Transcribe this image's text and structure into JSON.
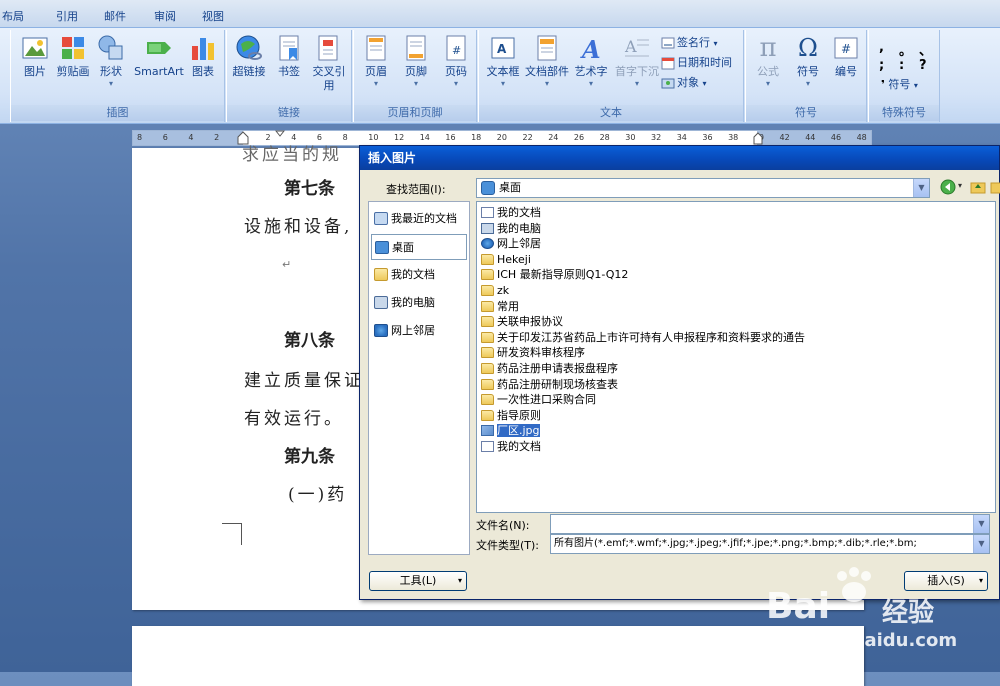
{
  "ribbon": {
    "tabs": [
      "布局",
      "引用",
      "邮件",
      "审阅",
      "视图"
    ],
    "groups": {
      "illustrations": {
        "label": "插图",
        "buttons": [
          "图片",
          "剪贴画",
          "形状",
          "SmartArt",
          "图表"
        ]
      },
      "links": {
        "label": "链接",
        "buttons": [
          "超链接",
          "书签",
          "交叉引用"
        ]
      },
      "header_footer": {
        "label": "页眉和页脚",
        "buttons": [
          "页眉",
          "页脚",
          "页码"
        ]
      },
      "text": {
        "label": "文本",
        "buttons": [
          "文本框",
          "文档部件",
          "艺术字",
          "首字下沉"
        ],
        "small": [
          "签名行",
          "日期和时间",
          "对象"
        ]
      },
      "symbols": {
        "label": "符号",
        "buttons": [
          "公式",
          "符号",
          "编号"
        ]
      },
      "special": {
        "label": "特殊符号",
        "chars": [
          ",",
          "。",
          "、",
          ";",
          ":",
          "?"
        ],
        "symbol_label": "符号"
      }
    }
  },
  "ruler": {
    "numbers": [
      "8",
      "6",
      "4",
      "2",
      "",
      "2",
      "4",
      "6",
      "8",
      "10",
      "12",
      "14",
      "16",
      "18",
      "20",
      "22",
      "24",
      "26",
      "28",
      "30",
      "32",
      "34",
      "36",
      "38",
      "40",
      "42",
      "44",
      "46",
      "48"
    ]
  },
  "document": {
    "lines": [
      {
        "text": "第七条",
        "style": "head"
      },
      {
        "text": "设施和设备,",
        "style": "body"
      },
      {
        "text": "第八条",
        "style": "head"
      },
      {
        "text": "建立质量保证",
        "style": "body"
      },
      {
        "text": "有效运行。",
        "style": "body"
      },
      {
        "text": "第九条",
        "style": "head"
      },
      {
        "text": "(一)药",
        "style": "body"
      }
    ],
    "partial_top": "求应当的规",
    "para_mark": "↵"
  },
  "dialog": {
    "title": "插入图片",
    "look_in_label": "查找范围(I):",
    "look_in_value": "桌面",
    "places": [
      {
        "label": "我最近的文档",
        "icon": "recent-docs-icon"
      },
      {
        "label": "桌面",
        "icon": "desktop-icon"
      },
      {
        "label": "我的文档",
        "icon": "my-documents-icon"
      },
      {
        "label": "我的电脑",
        "icon": "my-computer-icon"
      },
      {
        "label": "网上邻居",
        "icon": "network-icon"
      }
    ],
    "files": [
      {
        "name": "我的文档",
        "icon": "doc"
      },
      {
        "name": "我的电脑",
        "icon": "comp"
      },
      {
        "name": "网上邻居",
        "icon": "net"
      },
      {
        "name": "Hekeji",
        "icon": "folder"
      },
      {
        "name": "ICH 最新指导原则Q1-Q12",
        "icon": "folder"
      },
      {
        "name": "zk",
        "icon": "folder"
      },
      {
        "name": "常用",
        "icon": "folder"
      },
      {
        "name": "关联申报协议",
        "icon": "folder"
      },
      {
        "name": "关于印发江苏省药品上市许可持有人申报程序和资料要求的通告",
        "icon": "folder"
      },
      {
        "name": "研发资料审核程序",
        "icon": "folder"
      },
      {
        "name": "药品注册申请表报盘程序",
        "icon": "folder"
      },
      {
        "name": "药品注册研制现场核查表",
        "icon": "folder"
      },
      {
        "name": "一次性进口采购合同",
        "icon": "folder"
      },
      {
        "name": "指导原则",
        "icon": "folder"
      },
      {
        "name": "厂区.jpg",
        "icon": "img",
        "selected": true
      },
      {
        "name": "我的文档",
        "icon": "doc"
      }
    ],
    "file_name_label": "文件名(N):",
    "file_name_value": "",
    "file_type_label": "文件类型(T):",
    "file_type_value": "所有图片(*.emf;*.wmf;*.jpg;*.jpeg;*.jfif;*.jpe;*.png;*.bmp;*.dib;*.rle;*.bm;",
    "tools_button": "工具(L)",
    "insert_button": "插入(S)"
  },
  "watermark": {
    "brand": "Bai",
    "brand2": "经验",
    "url": "jingyan.baidu.com"
  }
}
